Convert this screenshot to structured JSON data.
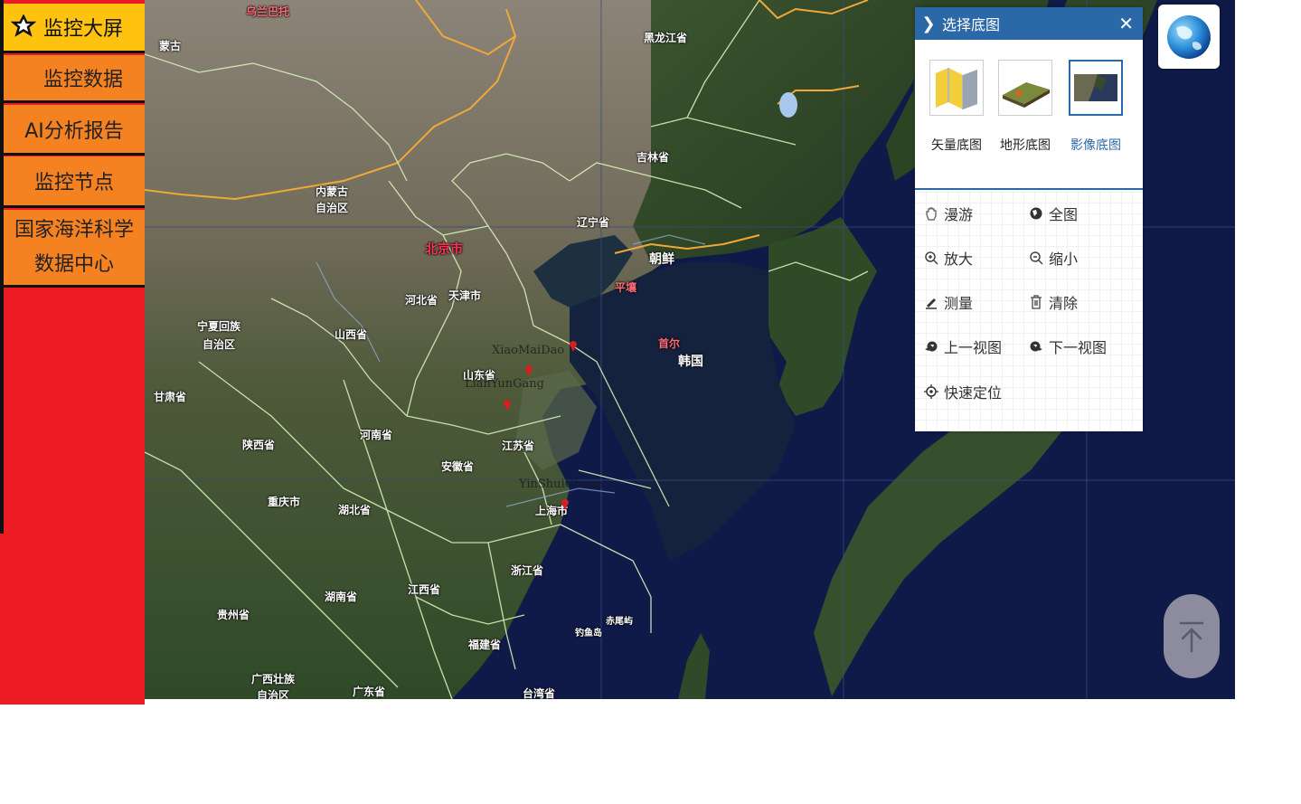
{
  "sidebar": {
    "items": [
      {
        "label": "监控大屏",
        "icon": "star-icon"
      },
      {
        "label": "监控数据"
      },
      {
        "label": "AI分析报告"
      },
      {
        "label": "监控节点"
      },
      {
        "label": "国家海洋科学数据中心"
      }
    ]
  },
  "map": {
    "labels": {
      "mongolia": "蒙古",
      "ulanbator": "乌兰巴托",
      "heilongjiang": "黑龙江省",
      "jilin": "吉林省",
      "liaoning": "辽宁省",
      "neimenggu": "内蒙古\n自治区",
      "beijing": "北京市",
      "tianjin": "天津市",
      "hebei": "河北省",
      "shanxi": "山西省",
      "ningxia": "宁夏回族\n自治区",
      "gansu": "甘肃省",
      "shaanxi": "陕西省",
      "henan": "河南省",
      "shandong": "山东省",
      "jiangsu": "江苏省",
      "anhui": "安徽省",
      "shanghai": "上海市",
      "chongqing": "重庆市",
      "hubei": "湖北省",
      "zhejiang": "浙江省",
      "jiangxi": "江西省",
      "hunan": "湖南省",
      "guizhou": "贵州省",
      "fujian": "福建省",
      "guangxi": "广西壮族\n自治区",
      "guangdong": "广东省",
      "taiwan": "台湾省",
      "chixiwei": "赤尾屿",
      "diaoyudao": "钓鱼岛",
      "northkorea": "朝鲜",
      "pyongyang": "平壤",
      "southkorea": "韩国",
      "seoul": "首尔"
    },
    "markers": [
      {
        "label": "XiaoMaiDao"
      },
      {
        "label": "LianYunGang"
      },
      {
        "label": "YinShuiChuan"
      }
    ]
  },
  "panel": {
    "title": "选择底图",
    "close_icon": "close-icon",
    "basemaps": [
      {
        "label": "矢量底图",
        "selected": false
      },
      {
        "label": "地形底图",
        "selected": false
      },
      {
        "label": "影像底图",
        "selected": true
      }
    ],
    "tools": [
      {
        "label": "漫游",
        "icon": "hand-icon"
      },
      {
        "label": "全图",
        "icon": "globe-icon"
      },
      {
        "label": "放大",
        "icon": "zoom-in-icon"
      },
      {
        "label": "缩小",
        "icon": "zoom-out-icon"
      },
      {
        "label": "测量",
        "icon": "ruler-icon"
      },
      {
        "label": "清除",
        "icon": "trash-icon"
      },
      {
        "label": "上一视图",
        "icon": "prev-view-icon"
      },
      {
        "label": "下一视图",
        "icon": "next-view-icon"
      },
      {
        "label": "快速定位",
        "icon": "locate-icon"
      }
    ]
  },
  "colors": {
    "accent": "#2b68a8",
    "nav_active": "#ffc20e",
    "nav_item": "#f58220",
    "sidebar_bg": "#ed1c24"
  }
}
